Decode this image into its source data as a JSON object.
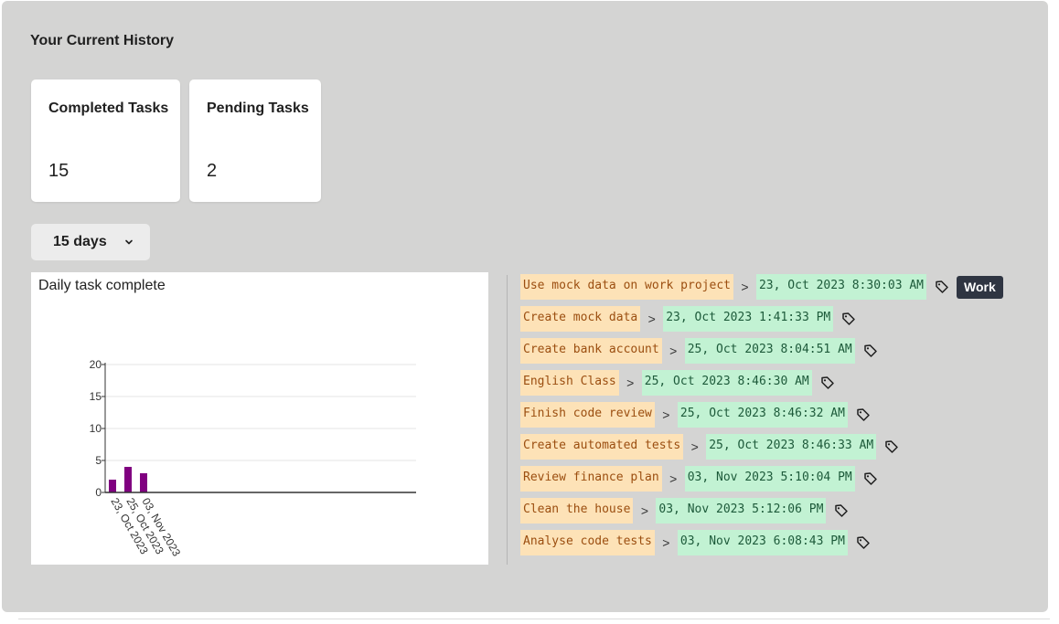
{
  "history": {
    "title": "Your Current History"
  },
  "stats": {
    "completed": {
      "label": "Completed Tasks",
      "value": "15"
    },
    "pending": {
      "label": "Pending Tasks",
      "value": "2"
    }
  },
  "range": {
    "selected": "15 days"
  },
  "chart_data": {
    "type": "bar",
    "title": "Daily task complete",
    "categories": [
      "23, Oct 2023",
      "25, Oct 2023",
      "03, Nov 2023"
    ],
    "values": [
      2,
      4,
      3
    ],
    "ylim": [
      0,
      20
    ],
    "yticks": [
      0,
      5,
      10,
      15,
      20
    ],
    "bar_color": "#800080",
    "grid": true,
    "xlabel": "",
    "ylabel": ""
  },
  "tasks": [
    {
      "name": "Use mock data on work project",
      "date": "23, Oct 2023 8:30:03 AM",
      "tag": "Work"
    },
    {
      "name": "Create mock data",
      "date": "23, Oct 2023 1:41:33 PM"
    },
    {
      "name": "Create bank account",
      "date": "25, Oct 2023 8:04:51 AM"
    },
    {
      "name": "English Class",
      "date": "25, Oct 2023 8:46:30 AM"
    },
    {
      "name": "Finish code review",
      "date": "25, Oct 2023 8:46:32 AM"
    },
    {
      "name": "Create automated tests",
      "date": "25, Oct 2023 8:46:33 AM"
    },
    {
      "name": "Review finance plan",
      "date": "03, Nov 2023 5:10:04 PM"
    },
    {
      "name": "Clean the house",
      "date": "03, Nov 2023 5:12:06 PM"
    },
    {
      "name": "Analyse code tests",
      "date": "03, Nov 2023 6:08:43 PM"
    }
  ],
  "separator": ">",
  "icons": {
    "tag": "tag-icon",
    "chevron": "chevron-down-icon"
  },
  "colors": {
    "task_bg": "#fde2b7",
    "date_bg": "#c2f2d3",
    "tooltip_bg": "#2f3542"
  }
}
